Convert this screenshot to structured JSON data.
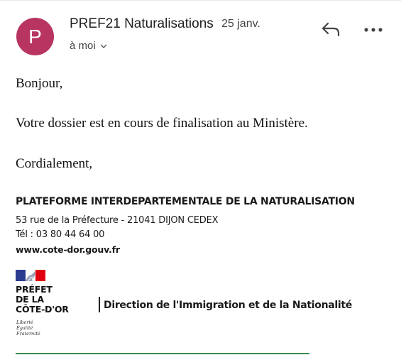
{
  "header": {
    "avatar_letter": "P",
    "avatar_color": "#b83561",
    "sender": "PREF21 Naturalisations",
    "date": "25 janv.",
    "recipient": "à moi",
    "icons": {
      "reply": "reply-icon",
      "more": "more-options-icon",
      "expand": "chevron-down-icon"
    }
  },
  "message": {
    "greeting": "Bonjour,",
    "body": "Votre dossier est en cours de finalisation au Ministère.",
    "closing": "Cordialement,"
  },
  "signature": {
    "title": "PLATEFORME INTERDEPARTEMENTALE DE LA NATURALISATION",
    "address": "53 rue de la Préfecture - 21041 DIJON CEDEX",
    "phone": "Tél : 03 80 44 64 00",
    "website": "www.cote-dor.gouv.fr",
    "logo": {
      "line1": "PRÉFET",
      "line2": "DE LA",
      "line3": "CÔTE-D'OR",
      "motto1": "Liberté",
      "motto2": "Égalité",
      "motto3": "Fraternité"
    },
    "direction": "Direction de l'Immigration et de la Nationalité",
    "accent_color": "#3c8c4c"
  }
}
